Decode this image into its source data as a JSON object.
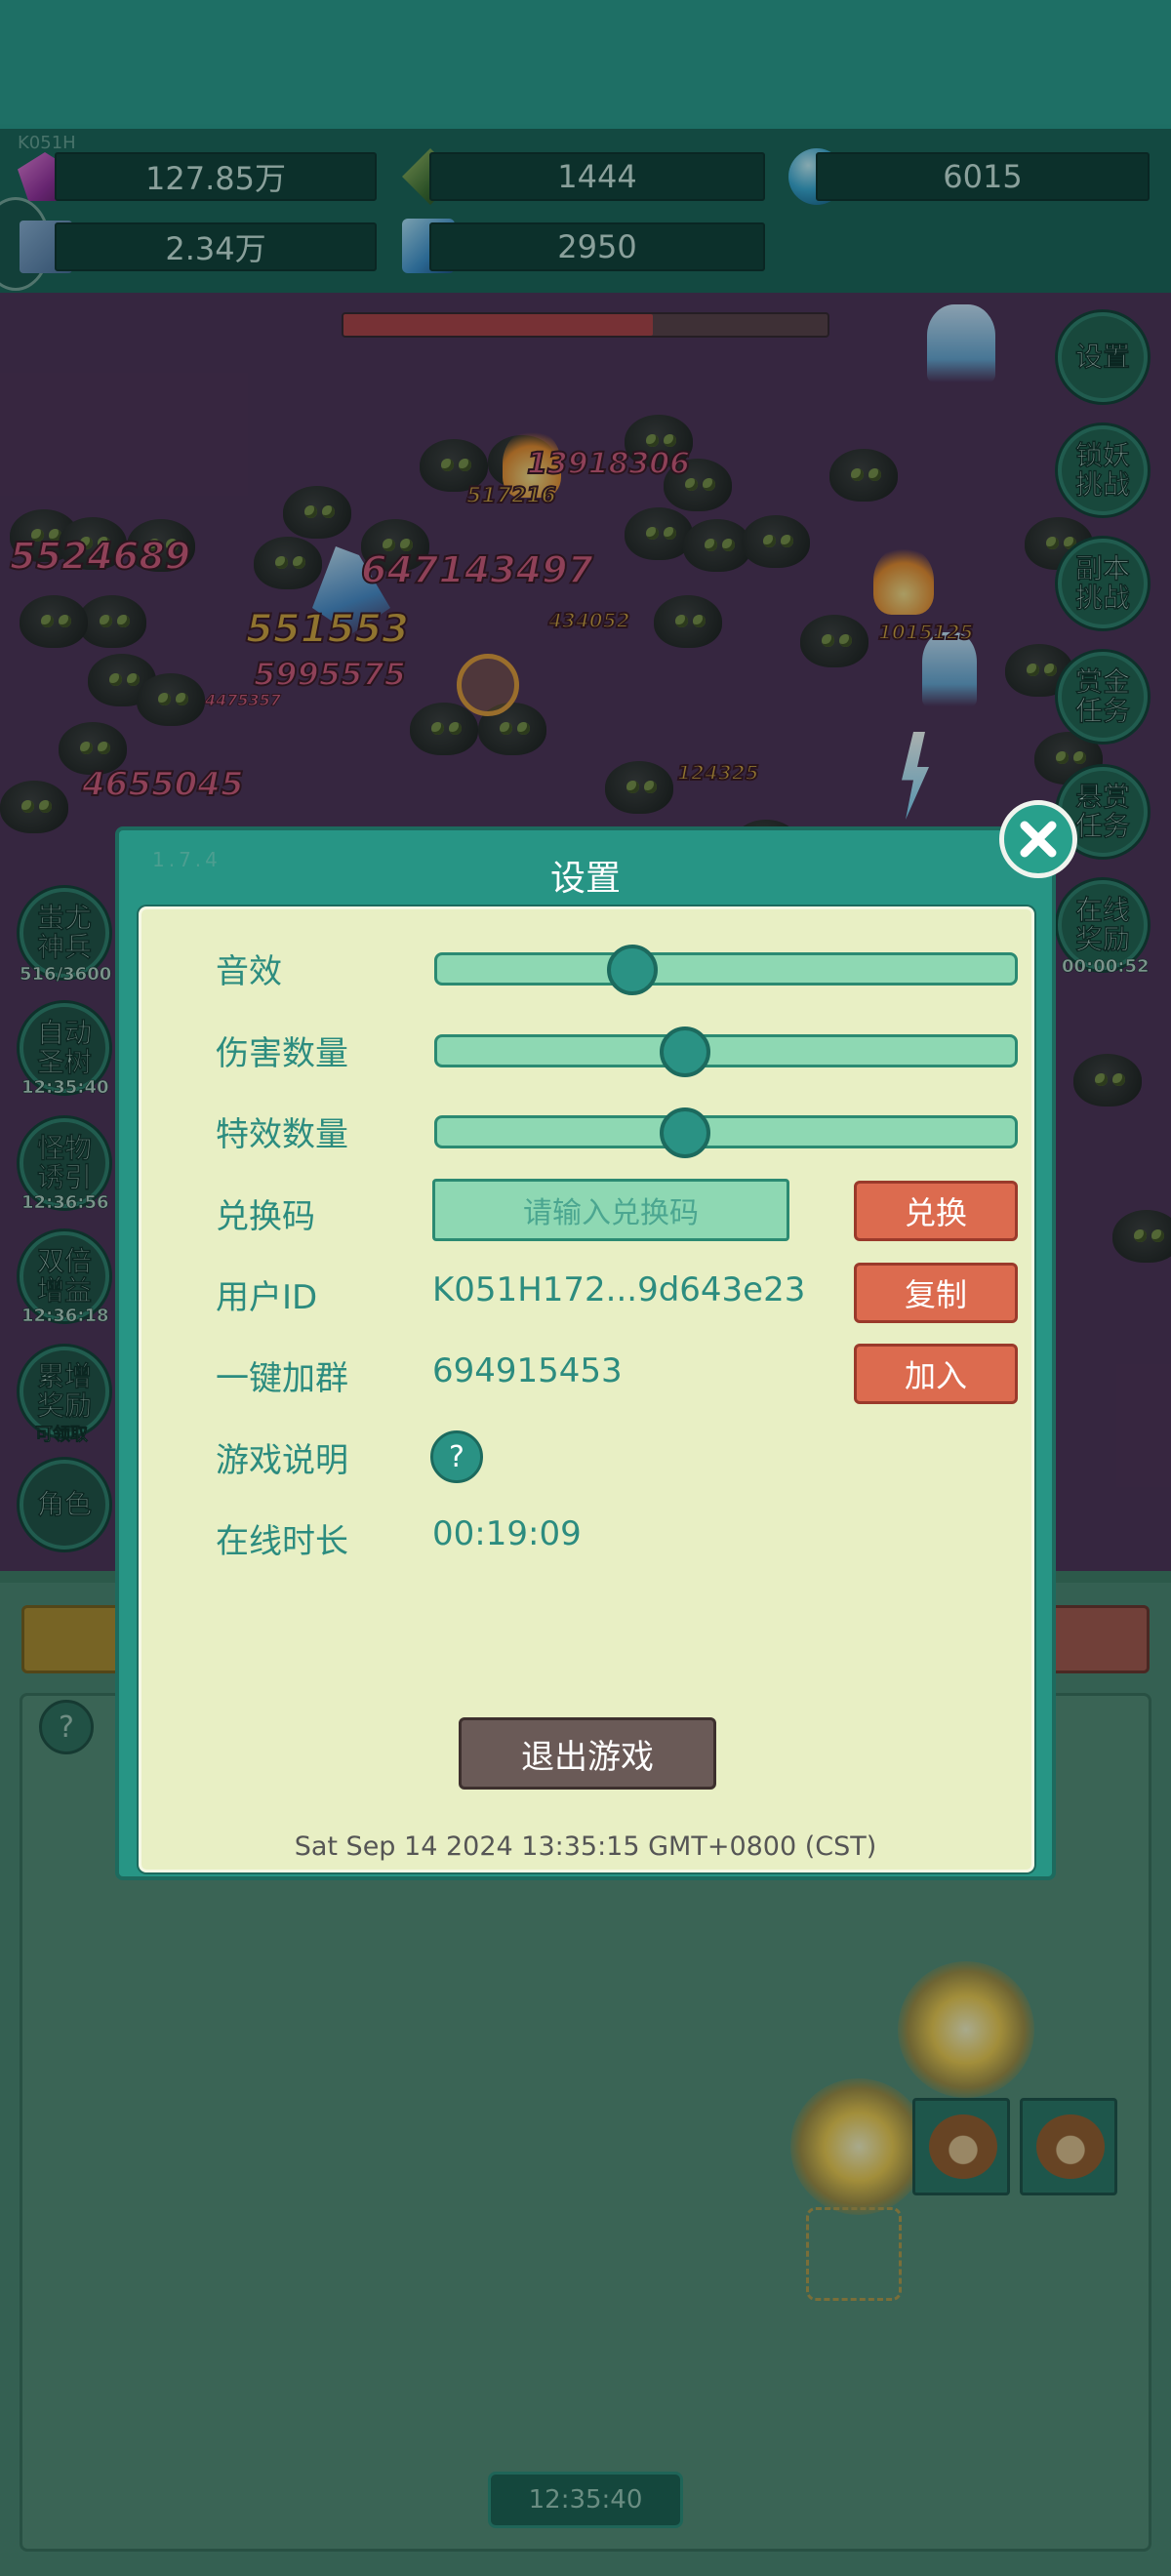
{
  "resources": {
    "gem": "127.85万",
    "leaf_gem": "1444",
    "orb": "6015",
    "scroll": "2.34万",
    "crystal": "2950"
  },
  "top_tiny_id": "K051H",
  "damage_numbers": {
    "n1": "5524689",
    "n2": "647143497",
    "n3": "13918306",
    "n4": "551553",
    "n5": "5995575",
    "n6": "4655045",
    "n7": "517216",
    "n8": "434052",
    "n9": "1015125",
    "n10": "124325",
    "n11": "4475357"
  },
  "right_buttons": {
    "settings": "设置",
    "lock_demon": "锁妖\n挑战",
    "dungeon": "副本\n挑战",
    "bounty": "赏金\n任务",
    "reward_task": "悬赏\n任务",
    "online_reward": "在线\n奖励",
    "online_reward_time": "00:00:52"
  },
  "left_buttons": {
    "chiyou": "蚩尤\n神兵",
    "chiyou_sub": "516/3600",
    "auto_tree": "自动\n圣树",
    "auto_tree_sub": "12:35:40",
    "lure": "怪物\n诱引",
    "lure_sub": "12:36:56",
    "double": "双倍\n增益",
    "double_sub": "12:36:18",
    "accum": "累增\n奖励",
    "accum_sub": "可领取",
    "role": "角色"
  },
  "dialog": {
    "title": "设置",
    "version": "1.7.4",
    "sound_label": "音效",
    "sound_level": 0.2,
    "damage_count_label": "伤害数量",
    "damage_count_level": 0.3,
    "effects_label": "特效数量",
    "effects_level": 0.3,
    "redeem_label": "兑换码",
    "redeem_placeholder": "请输入兑换码",
    "redeem_button": "兑换",
    "user_id_label": "用户ID",
    "user_id_value": "K051H172...9d643e23",
    "copy_button": "复制",
    "group_label": "一键加群",
    "group_value": "694915453",
    "join_button": "加入",
    "instructions_label": "游戏说明",
    "help_glyph": "?",
    "online_label": "在线时长",
    "online_value": "00:19:09",
    "exit_button": "退出游戏",
    "datetime": "Sat Sep 14 2024 13:35:15 GMT+0800 (CST)"
  },
  "bottom": {
    "help_glyph": "?",
    "timer": "12:35:40"
  },
  "colors": {
    "teal": "#279585",
    "panel": "#e8efc4",
    "red_button": "#dc6b4f",
    "field": "#4f2b55"
  }
}
